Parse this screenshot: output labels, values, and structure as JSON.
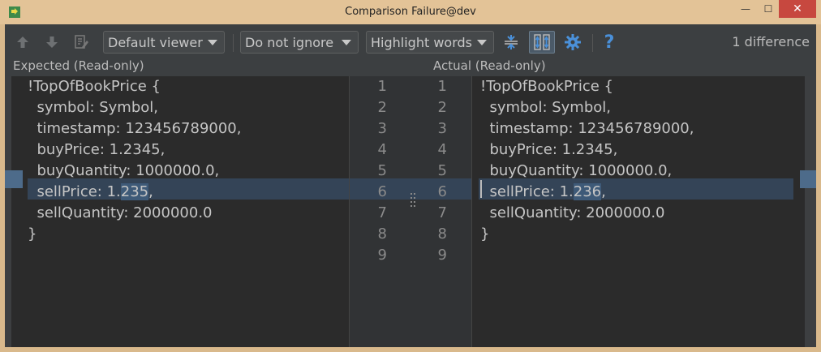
{
  "window": {
    "title": "Comparison Failure@dev",
    "minimize_glyph": "—",
    "maximize_glyph": "☐",
    "close_glyph": "✕"
  },
  "toolbar": {
    "viewer": "Default viewer",
    "ignore": "Do not ignore",
    "highlight": "Highlight words",
    "difference_count": "1 difference",
    "help_glyph": "?"
  },
  "icons": [
    "app-icon",
    "arrow-up-icon",
    "arrow-down-icon",
    "edit-source-icon",
    "collapse-unchanged-icon",
    "sync-scroll-icon",
    "settings-gear-icon",
    "help-icon"
  ],
  "colors": {
    "changed_band": "#344457",
    "word_highlight": "#3e5a78",
    "accent": "#4a90d9"
  },
  "panes": {
    "left": {
      "header": "Expected (Read-only)",
      "lines": [
        "!TopOfBookPrice {",
        "  symbol: Symbol,",
        "  timestamp: 123456789000,",
        "  buyPrice: 1.2345,",
        "  buyQuantity: 1000000.0,",
        "  sellPrice: 1.",
        "  sellQuantity: 2000000.0",
        "}",
        ""
      ],
      "changed_prefix": "  sellPrice: 1.",
      "changed_word": "235",
      "changed_suffix": ","
    },
    "right": {
      "header": "Actual (Read-only)",
      "lines": [
        "!TopOfBookPrice {",
        "  symbol: Symbol,",
        "  timestamp: 123456789000,",
        "  buyPrice: 1.2345,",
        "  buyQuantity: 1000000.0,",
        "  sellPrice: 1.",
        "  sellQuantity: 2000000.0",
        "}",
        ""
      ],
      "changed_prefix": "  sellPrice: 1.",
      "changed_word": "236",
      "changed_suffix": ","
    }
  },
  "gutter": {
    "left_numbers": [
      "1",
      "2",
      "3",
      "4",
      "5",
      "6",
      "7",
      "8",
      "9"
    ],
    "right_numbers": [
      "1",
      "2",
      "3",
      "4",
      "5",
      "6",
      "7",
      "8",
      "9"
    ],
    "changed_line": 6
  }
}
